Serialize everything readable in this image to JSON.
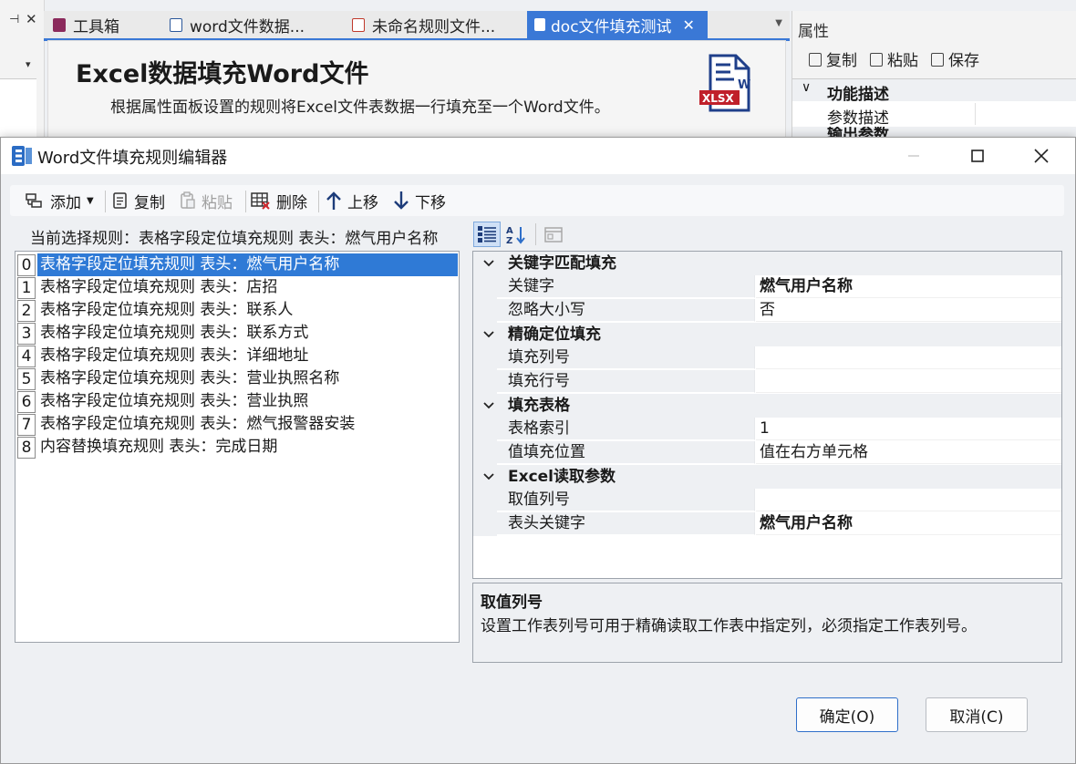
{
  "ide": {
    "tabs": [
      {
        "label": "工具箱",
        "icon": "toolbox-icon",
        "color": "#8b2a5c"
      },
      {
        "label": "word文件数据...",
        "icon": "word-file-icon",
        "color": "#2b579a"
      },
      {
        "label": "未命名规则文件...",
        "icon": "rule-file-icon",
        "color": "#c0392b"
      },
      {
        "label": "doc文件填充测试",
        "icon": "doc-file-icon",
        "color": "#ffffff"
      }
    ],
    "tab_close": "✕",
    "doc_title": "Excel数据填充Word文件",
    "doc_subtitle": "根据属性面板设置的规则将Excel文件表数据一行填充至一个Word文件。",
    "doc_icon_text": "XLSX",
    "doc_icon_letter": "W",
    "properties": {
      "title": "属性",
      "toolbar": [
        "复制",
        "粘贴",
        "保存"
      ],
      "category": "功能描述",
      "row": "参数描述",
      "partial_category": "输出参数"
    }
  },
  "dialog": {
    "title": "Word文件填充规则编辑器",
    "toolbar": {
      "add": "添加",
      "copy": "复制",
      "paste": "粘贴",
      "delete": "删除",
      "move_up": "上移",
      "move_down": "下移"
    },
    "current_rule": "当前选择规则：表格字段定位填充规则 表头：燃气用户名称",
    "rules": [
      {
        "index": "0",
        "text": "表格字段定位填充规则 表头：燃气用户名称",
        "selected": true
      },
      {
        "index": "1",
        "text": "表格字段定位填充规则 表头：店招",
        "selected": false
      },
      {
        "index": "2",
        "text": "表格字段定位填充规则 表头：联系人",
        "selected": false
      },
      {
        "index": "3",
        "text": "表格字段定位填充规则 表头：联系方式",
        "selected": false
      },
      {
        "index": "4",
        "text": "表格字段定位填充规则 表头：详细地址",
        "selected": false
      },
      {
        "index": "5",
        "text": "表格字段定位填充规则 表头：营业执照名称",
        "selected": false
      },
      {
        "index": "6",
        "text": "表格字段定位填充规则 表头：营业执照",
        "selected": false
      },
      {
        "index": "7",
        "text": "表格字段定位填充规则 表头：燃气报警器安装",
        "selected": false
      },
      {
        "index": "8",
        "text": "内容替换填充规则 表头：完成日期",
        "selected": false
      }
    ],
    "property_grid": [
      {
        "category": "关键字匹配填充",
        "rows": [
          {
            "name": "关键字",
            "value": "燃气用户名称",
            "bold": true
          },
          {
            "name": "忽略大小写",
            "value": "否",
            "bold": false
          }
        ]
      },
      {
        "category": "精确定位填充",
        "rows": [
          {
            "name": "填充列号",
            "value": "",
            "bold": false
          },
          {
            "name": "填充行号",
            "value": "",
            "bold": false
          }
        ]
      },
      {
        "category": "填充表格",
        "rows": [
          {
            "name": "表格索引",
            "value": "1",
            "bold": false
          },
          {
            "name": "值填充位置",
            "value": "值在右方单元格",
            "bold": false
          }
        ]
      },
      {
        "category": "Excel读取参数",
        "rows": [
          {
            "name": "取值列号",
            "value": "",
            "bold": false
          },
          {
            "name": "表头关键字",
            "value": "燃气用户名称",
            "bold": true
          }
        ]
      }
    ],
    "description": {
      "title": "取值列号",
      "text": "设置工作表列号可用于精确读取工作表中指定列，必须指定工作表列号。"
    },
    "ok": "确定(O)",
    "cancel": "取消(C)"
  },
  "colors": {
    "accent": "#3a78d6",
    "selection": "#2f7ad6"
  }
}
